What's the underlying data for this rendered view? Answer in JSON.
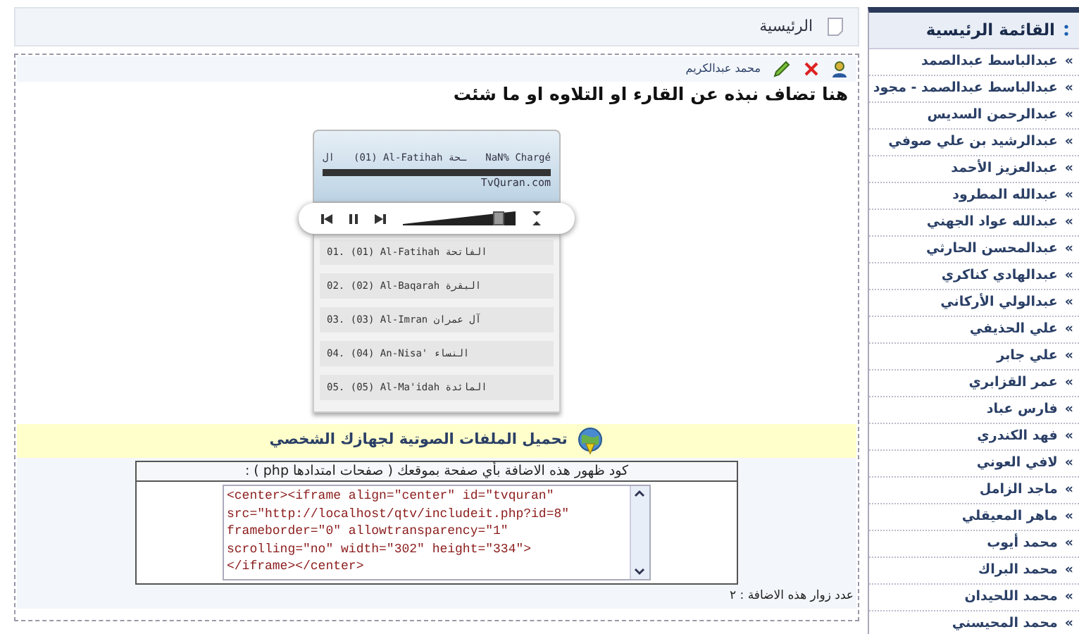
{
  "breadcrumb": {
    "label": "الرئيسية"
  },
  "post": {
    "author": "محمد عبدالكريم",
    "title": "هنا تضاف نبذه عن القارء او التلاوه او ما شئت",
    "player": {
      "prefix": "ال",
      "now_playing": "(01) Al-Fatihah ـحة",
      "status": "NaN% Chargé",
      "site": "TvQuran.com",
      "volume": {
        "level": 0.9
      },
      "tracks": [
        {
          "label": "01. (01) Al-Fatihah الفاتحة"
        },
        {
          "label": "02. (02) Al-Baqarah البقرة"
        },
        {
          "label": "03. (03) Al-Imran آل عمران"
        },
        {
          "label": "04. (04) An-Nisa' النساء"
        },
        {
          "label": "05. (05) Al-Ma'idah المائدة"
        }
      ]
    },
    "download_label": "تحميل الملفات الصوتية لجهازك الشخصي",
    "embed": {
      "caption": "كود ظهور هذه الاضافة بأي صفحة بموقعك ( صفحات امتدادها php ) :",
      "code_lines": [
        "<center><iframe align=\"center\" id=\"tvquran\"",
        "src=\"http://localhost/qtv/includeit.php?id=8\"",
        "frameborder=\"0\" allowtransparency=\"1\"",
        "scrolling=\"no\" width=\"302\" height=\"334\">",
        "</iframe></center>"
      ]
    },
    "visitors": "عدد زوار هذه الاضافة : ٢"
  },
  "sidebar": {
    "title": "القائمة الرئيسية",
    "items": [
      {
        "bullet": "»",
        "label": "عبدالباسط عبدالصمد"
      },
      {
        "bullet": "»",
        "label": "عبدالباسط عبدالصمد - مجود"
      },
      {
        "bullet": "»",
        "label": "عبدالرحمن السديس"
      },
      {
        "bullet": "»",
        "label": "عبدالرشيد بن علي صوفي"
      },
      {
        "bullet": "»",
        "label": "عبدالعزيز الأحمد"
      },
      {
        "bullet": "»",
        "label": "عبدالله المطرود"
      },
      {
        "bullet": "»",
        "label": "عبدالله عواد الجهني"
      },
      {
        "bullet": "»",
        "label": "عبدالمحسن الحارثي"
      },
      {
        "bullet": "»",
        "label": "عبدالهادي كناكري"
      },
      {
        "bullet": "»",
        "label": "عبدالولي الأركاني"
      },
      {
        "bullet": "»",
        "label": "علي الحذيفي"
      },
      {
        "bullet": "»",
        "label": "علي جابر"
      },
      {
        "bullet": "»",
        "label": "عمر القزابري"
      },
      {
        "bullet": "»",
        "label": "فارس عباد"
      },
      {
        "bullet": "»",
        "label": "فهد الكندري"
      },
      {
        "bullet": "»",
        "label": "لافي العوني"
      },
      {
        "bullet": "»",
        "label": "ماجد الزامل"
      },
      {
        "bullet": "»",
        "label": "ماهر المعيقلي"
      },
      {
        "bullet": "»",
        "label": "محمد أيوب"
      },
      {
        "bullet": "»",
        "label": "محمد البراك"
      },
      {
        "bullet": "»",
        "label": "محمد اللحيدان"
      },
      {
        "bullet": "»",
        "label": "محمد المحيسني"
      }
    ]
  }
}
